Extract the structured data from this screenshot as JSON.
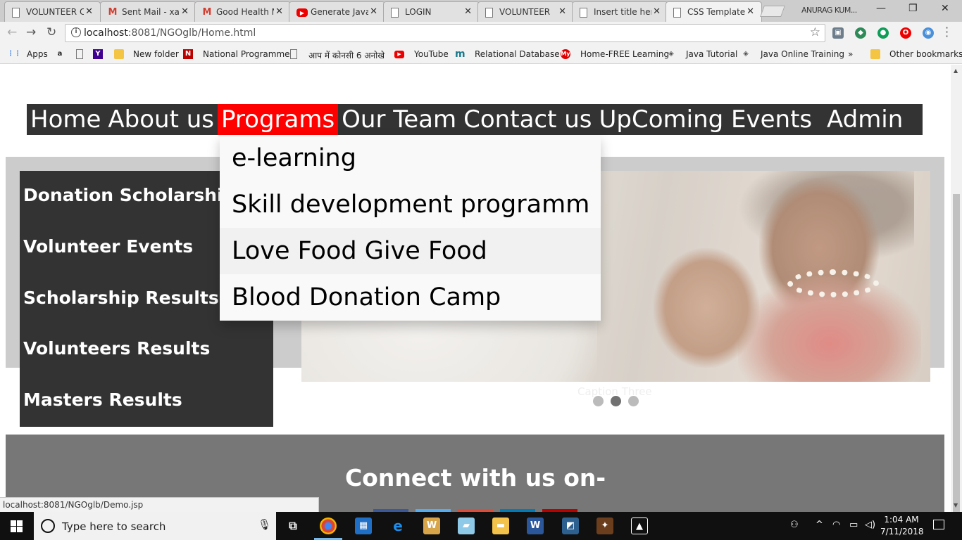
{
  "browser": {
    "tabs": [
      {
        "title": "VOLUNTEER Ch",
        "favicon": "doc-icon"
      },
      {
        "title": "Sent Mail - xa",
        "favicon": "gmail-icon"
      },
      {
        "title": "Good Health M",
        "favicon": "gmail-icon"
      },
      {
        "title": "Generate Java",
        "favicon": "youtube-icon"
      },
      {
        "title": "LOGIN",
        "favicon": "doc-icon"
      },
      {
        "title": "VOLUNTEER",
        "favicon": "doc-icon"
      },
      {
        "title": "Insert title her",
        "favicon": "doc-icon"
      },
      {
        "title": "CSS Template",
        "favicon": "doc-icon",
        "active": true
      }
    ],
    "profile_name": "ANURAG KUM...",
    "url_host": "localhost",
    "url_path": ":8081/NGOglb/Home.html",
    "bookmarks": [
      "Apps",
      "",
      "",
      "",
      "New folder",
      "National Programme",
      "आप में कोनसी 6 अनोखे",
      "YouTube",
      "Relational Database",
      "Home-FREE Learning",
      "Java Tutorial",
      "Java Online Training",
      "»",
      "Other bookmarks"
    ],
    "status_url": "localhost:8081/NGOglb/Demo.jsp"
  },
  "page": {
    "nav": [
      "Home",
      "About us",
      "Programs",
      "Our Team",
      "Contact us",
      "UpComing Events",
      " Admin"
    ],
    "nav_active": "Programs",
    "dropdown": [
      "e-learning",
      "Skill development programm",
      "Love Food Give Food",
      "Blood Donation Camp"
    ],
    "dropdown_hover": "Love Food Give Food",
    "sidebar": [
      "Donation Scholarship",
      "Volunteer Events",
      "Scholarship Results",
      "Volunteers Results",
      "Masters Results"
    ],
    "slideshow": {
      "caption": "Caption Three",
      "dot_count": 3,
      "active_dot": 2
    },
    "footer_heading": "Connect with us on-",
    "social_colors": [
      "#3b5998",
      "#55acee",
      "#dd4b39",
      "#007bb5",
      "#bb0000"
    ]
  },
  "taskbar": {
    "search_placeholder": "Type here to search",
    "time": "1:04 AM",
    "date": "7/11/2018"
  },
  "colors": {
    "nav_bg": "#333333",
    "nav_active": "#ff0000",
    "band": "#cccccc",
    "footer": "#777777"
  }
}
